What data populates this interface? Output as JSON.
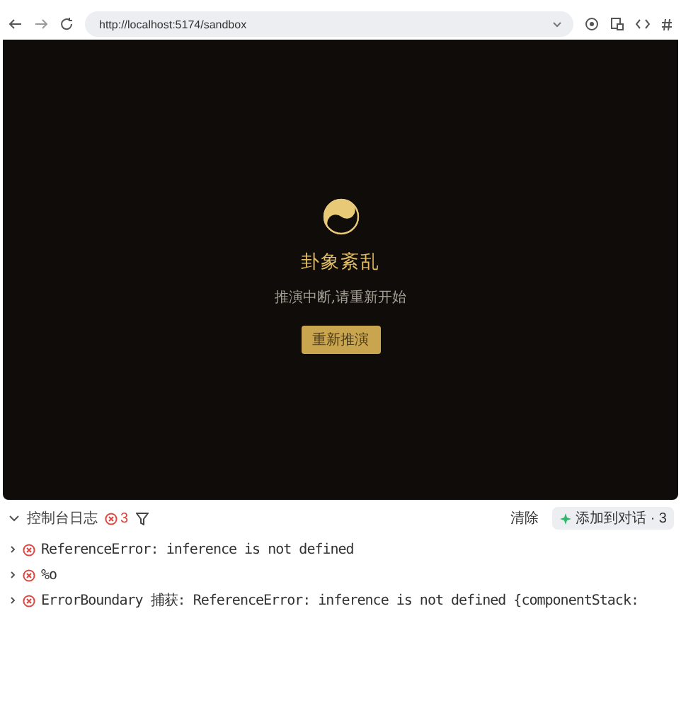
{
  "browser": {
    "url": "http://localhost:5174/sandbox"
  },
  "preview": {
    "title": "卦象紊乱",
    "message": "推演中断,请重新开始",
    "button": "重新推演"
  },
  "console": {
    "title": "控制台日志",
    "expanded": true,
    "error_count": "3",
    "clear": "清除",
    "add_button": "添加到对话 · 3",
    "logs": [
      {
        "text": "ReferenceError: inference is not defined",
        "expanded": false
      },
      {
        "text": "%o",
        "expanded": false
      },
      {
        "text": "ErrorBoundary 捕获: ReferenceError: inference is not defined {componentStack:",
        "expanded": false
      }
    ]
  }
}
